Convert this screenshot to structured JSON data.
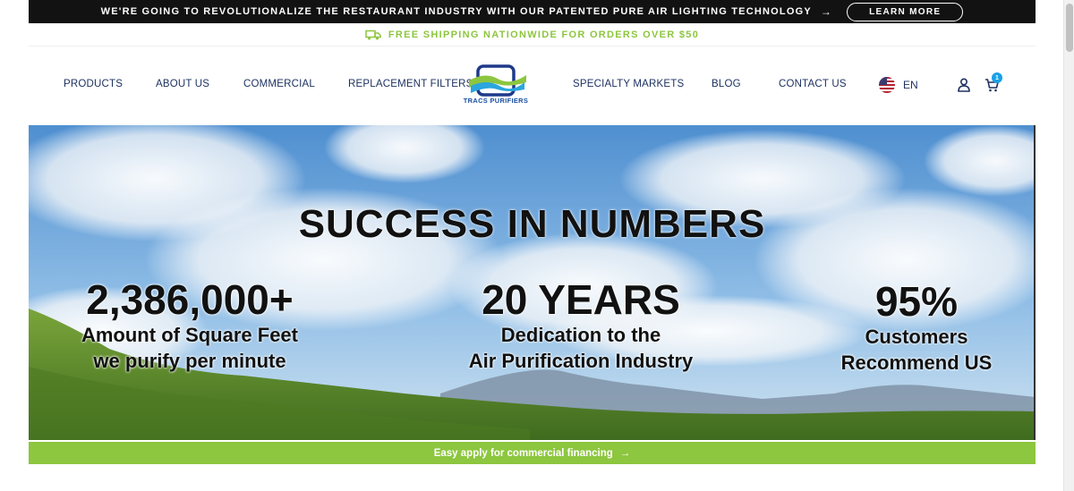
{
  "announcement": {
    "text": "WE'RE GOING TO REVOLUTIONALIZE THE RESTAURANT INDUSTRY WITH OUR PATENTED PURE AIR LIGHTING TECHNOLOGY",
    "arrow": "→",
    "button_label": "LEARN MORE"
  },
  "shipping": {
    "icon": "truck-icon",
    "text": "FREE SHIPPING NATIONWIDE FOR ORDERS OVER $50"
  },
  "nav": {
    "items": [
      "PRODUCTS",
      "ABOUT US",
      "COMMERCIAL",
      "REPLACEMENT FILTERS",
      "SPECIALTY MARKETS",
      "BLOG",
      "CONTACT US"
    ],
    "logo_text": "TRACS PURIFIERS",
    "language": "EN",
    "cart_count": "1"
  },
  "hero": {
    "title": "SUCCESS IN NUMBERS",
    "stats": [
      {
        "number": "2,386,000+",
        "line1": "Amount of Square Feet",
        "line2": "we purify per minute"
      },
      {
        "number": "20 YEARS",
        "line1": "Dedication to the",
        "line2": "Air Purification Industry"
      },
      {
        "number": "95%",
        "line1": "Customers",
        "line2": "Recommend US"
      }
    ]
  },
  "finance_bar": {
    "text": "Easy apply for commercial financing",
    "arrow": "→"
  },
  "colors": {
    "accent_green": "#8dc63f",
    "navy": "#1e3260",
    "badge_blue": "#1aa0e6",
    "topbar": "#121212"
  }
}
